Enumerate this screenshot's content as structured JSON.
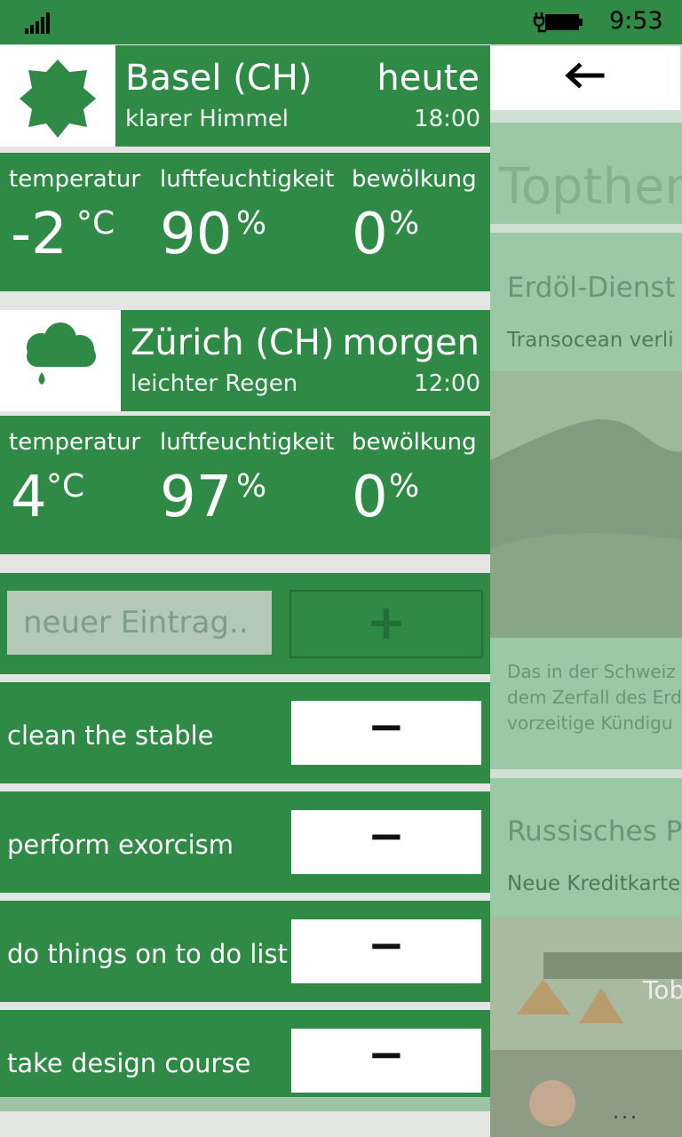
{
  "status_bar": {
    "time": "9:53"
  },
  "weather": [
    {
      "city": "Basel (CH)",
      "day": "heute",
      "condition": "klarer Himmel",
      "hour": "18:00",
      "icon": "sun-icon",
      "labels": {
        "temperature": "temperatur",
        "humidity": "luftfeuchtigkeit",
        "clouds": "bewölkung"
      },
      "temperature": "-2",
      "temperature_unit": "°C",
      "humidity": "90",
      "humidity_unit": "%",
      "clouds": "0",
      "clouds_unit": "%"
    },
    {
      "city": "Zürich (CH)",
      "day": "morgen",
      "condition": "leichter Regen",
      "hour": "12:00",
      "icon": "rain-cloud-icon",
      "labels": {
        "temperature": "temperatur",
        "humidity": "luftfeuchtigkeit",
        "clouds": "bewölkung"
      },
      "temperature": "4",
      "temperature_unit": "°C",
      "humidity": "97",
      "humidity_unit": "%",
      "clouds": "0",
      "clouds_unit": "%"
    }
  ],
  "todo": {
    "placeholder": "neuer Eintrag..",
    "add_label": "+",
    "remove_label": "−",
    "items": [
      {
        "text": "clean the stable"
      },
      {
        "text": "perform exorcism"
      },
      {
        "text": "do things on to do list"
      },
      {
        "text": "take design course"
      }
    ]
  },
  "news": {
    "back_icon": "arrow-left-icon",
    "section_title": "Topthem",
    "articles": [
      {
        "title": "Erdöl-Dienst",
        "subtitle": "Transocean verli",
        "teaser": [
          "Das in der Schweiz",
          "dem Zerfall des Erd",
          "vorzeitige Kündigu"
        ]
      },
      {
        "title": "Russisches P",
        "subtitle": "Neue Kreditkarte",
        "image_text": "Tob"
      }
    ],
    "more": "..."
  },
  "colors": {
    "accent": "#2e8a45",
    "panel_faded": "#9bc8a6"
  }
}
